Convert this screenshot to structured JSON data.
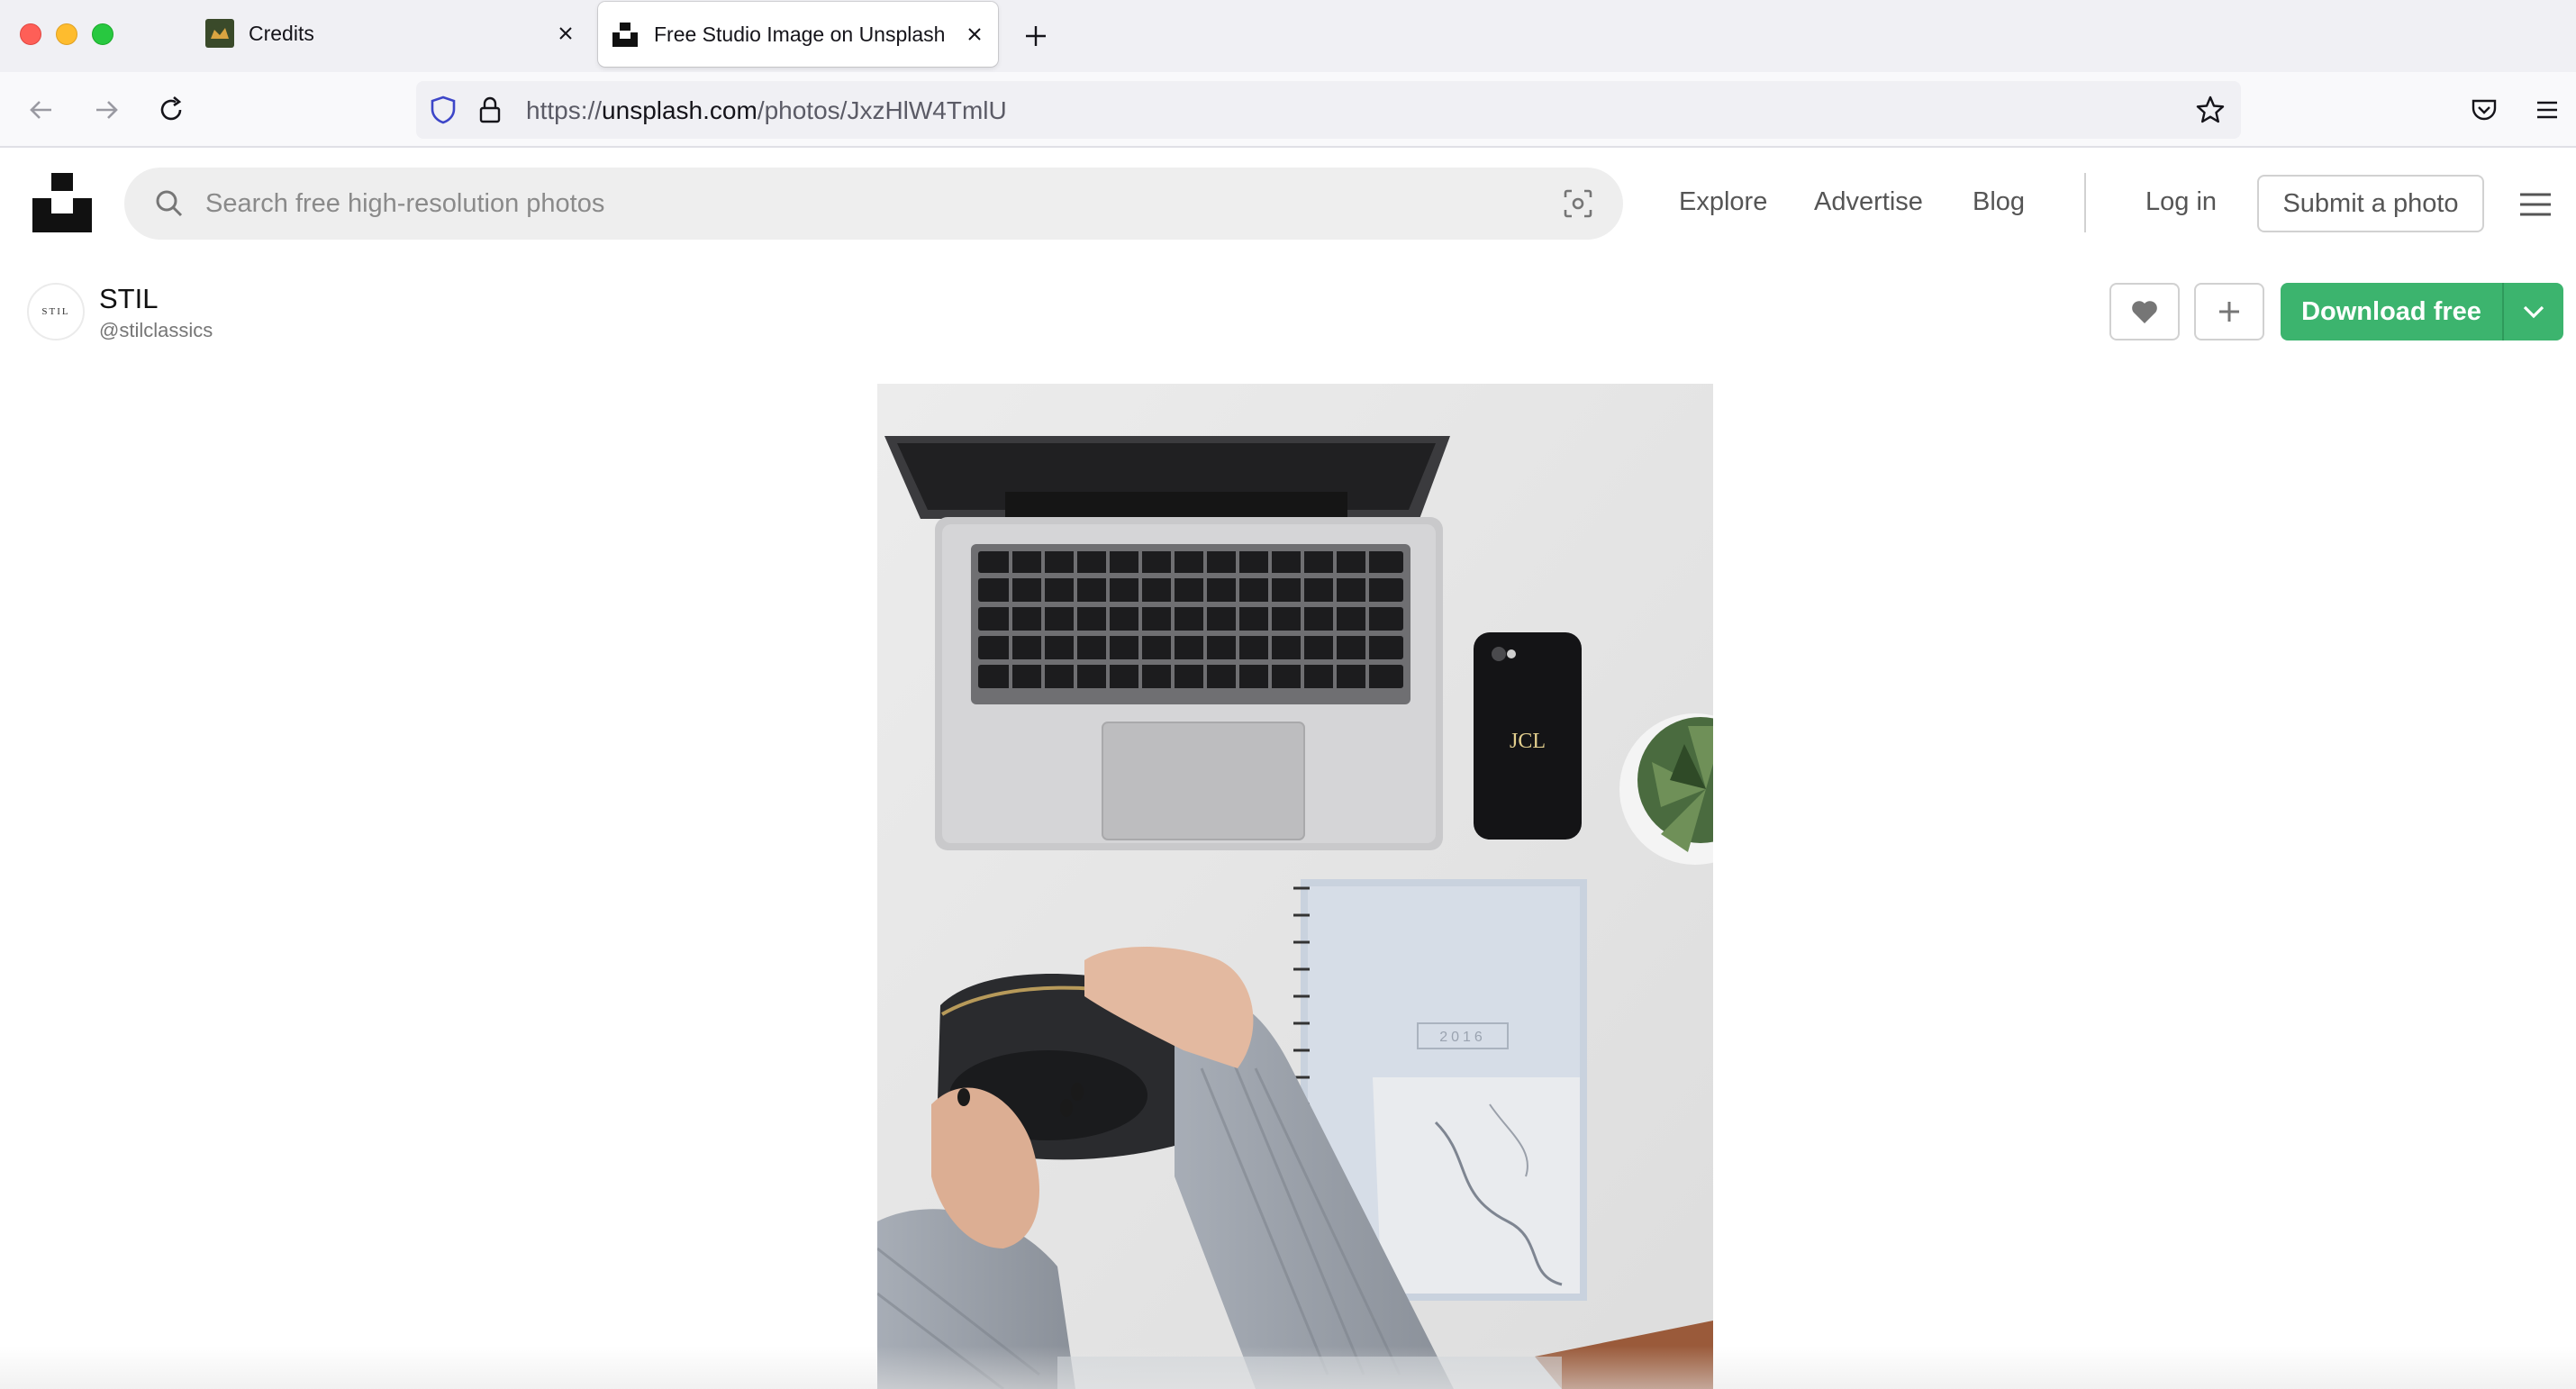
{
  "browser": {
    "tabs": [
      {
        "title": "Credits",
        "active": false
      },
      {
        "title": "Free Studio Image on Unsplash",
        "active": true
      }
    ],
    "url": {
      "scheme": "https://",
      "host": "unsplash.com",
      "path": "/photos/JxzHlW4TmlU"
    }
  },
  "header": {
    "search_placeholder": "Search free high-resolution photos",
    "nav": {
      "explore": "Explore",
      "advertise": "Advertise",
      "blog": "Blog"
    },
    "login": "Log in",
    "submit": "Submit a photo"
  },
  "author": {
    "avatar_text": "STIL",
    "name": "STIL",
    "handle": "@stilclassics"
  },
  "actions": {
    "download": "Download free"
  },
  "photo": {
    "phone_monogram": "JCL",
    "notebook_year": "2016"
  },
  "colors": {
    "download_green": "#3cb46e",
    "chrome_bg": "#f0f0f4"
  }
}
